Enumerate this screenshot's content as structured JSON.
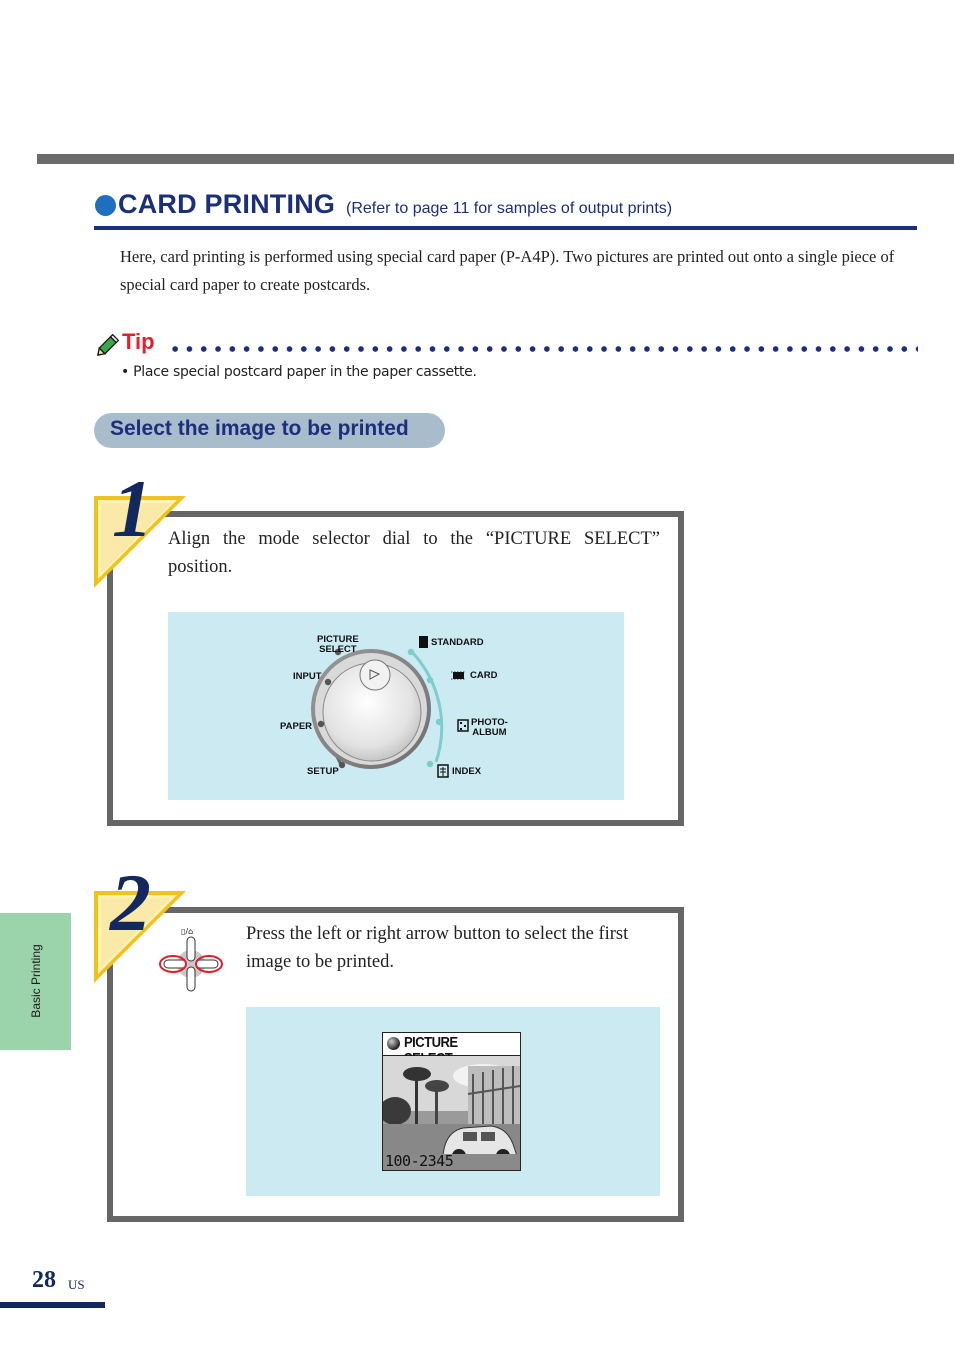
{
  "section": {
    "title": "CARD PRINTING",
    "subtitle": "(Refer to page 11 for samples of output prints)",
    "intro": "Here, card printing is performed using special card paper (P-A4P). Two pictures are printed out onto a single piece of special card paper to create postcards."
  },
  "tip": {
    "label": "Tip",
    "icon": "pencil-icon",
    "text": "• Place special postcard paper in the paper cassette."
  },
  "subheading": "Select the image to be printed",
  "steps": [
    {
      "number": "1",
      "text": "Align the mode selector dial to the “PICTURE SELECT” position.",
      "dial": {
        "left_labels": [
          "PICTURE SELECT",
          "INPUT",
          "PAPER",
          "SETUP"
        ],
        "right_labels": [
          "STANDARD",
          "CARD",
          "PHOTO- ALBUM",
          "INDEX"
        ],
        "picture_select_line1": "PICTURE",
        "picture_select_line2": "SELECT",
        "input": "INPUT",
        "paper": "PAPER",
        "setup": "SETUP",
        "standard": "STANDARD",
        "card": "CARD",
        "photo_line1": "PHOTO-",
        "photo_line2": "ALBUM",
        "index": "INDEX",
        "selected": "PICTURE SELECT"
      }
    },
    {
      "number": "2",
      "text": "Press the left or right arrow button to select the first image to be printed.",
      "button_label": "▯/⌂",
      "lcd": {
        "header": "PICTURE SELECT",
        "image_number": "100-2345"
      }
    }
  ],
  "side_tab": "Basic Printing",
  "footer": {
    "page_number": "28",
    "region": "US"
  },
  "colors": {
    "navy": "#1b2f7a",
    "accent_blue": "#1e6fbf",
    "tip_red": "#e3202a",
    "panel_blue": "#cbeaf2",
    "tab_green": "#9bd3aa",
    "border_gray": "#666666",
    "step_yellow": "#fbe9a8"
  }
}
